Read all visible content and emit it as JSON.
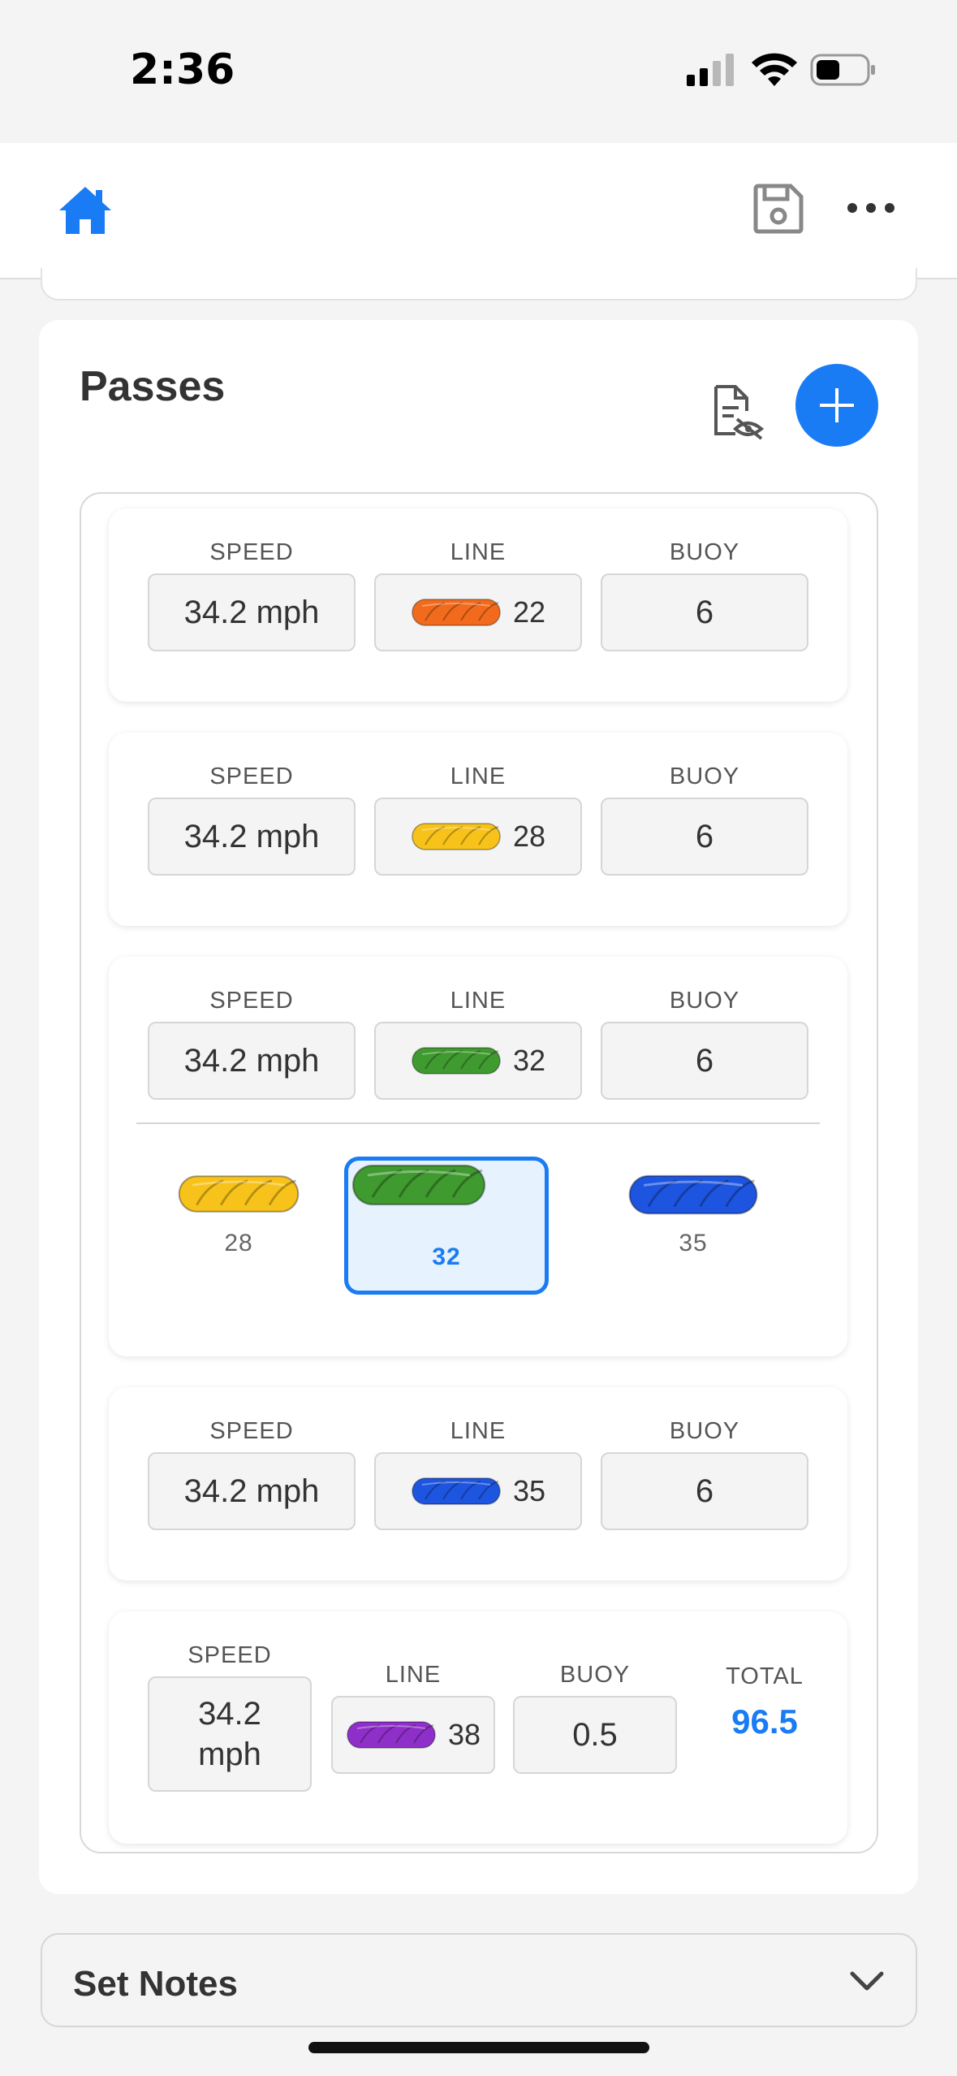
{
  "status_bar": {
    "time": "2:36"
  },
  "passes": {
    "title": "Passes",
    "rows": [
      {
        "speed_label": "SPEED",
        "speed": "34.2 mph",
        "line_label": "LINE",
        "line": "22",
        "line_color": "#f26b1d",
        "buoy_label": "BUOY",
        "buoy": "6"
      },
      {
        "speed_label": "SPEED",
        "speed": "34.2 mph",
        "line_label": "LINE",
        "line": "28",
        "line_color": "#f7c21a",
        "buoy_label": "BUOY",
        "buoy": "6"
      },
      {
        "speed_label": "SPEED",
        "speed": "34.2 mph",
        "line_label": "LINE",
        "line": "32",
        "line_color": "#3f9a2f",
        "buoy_label": "BUOY",
        "buoy": "6",
        "picker": [
          {
            "value": "28",
            "color": "#f7c21a"
          },
          {
            "value": "32",
            "color": "#3f9a2f",
            "selected": true
          },
          {
            "value": "35",
            "color": "#1d55e0"
          }
        ]
      },
      {
        "speed_label": "SPEED",
        "speed": "34.2 mph",
        "line_label": "LINE",
        "line": "35",
        "line_color": "#1d55e0",
        "buoy_label": "BUOY",
        "buoy": "6"
      },
      {
        "speed_label": "SPEED",
        "speed_line1": "34.2",
        "speed_line2": "mph",
        "line_label": "LINE",
        "line": "38",
        "line_color": "#8e2fc9",
        "buoy_label": "BUOY",
        "buoy": "0.5",
        "total_label": "TOTAL",
        "total": "96.5"
      }
    ]
  },
  "set_notes": {
    "title": "Set Notes"
  },
  "colors": {
    "accent": "#1a7cf5"
  },
  "icons": [
    "home-icon",
    "save-icon",
    "more-icon",
    "hide-document-icon",
    "plus-icon",
    "chevron-down-icon"
  ]
}
